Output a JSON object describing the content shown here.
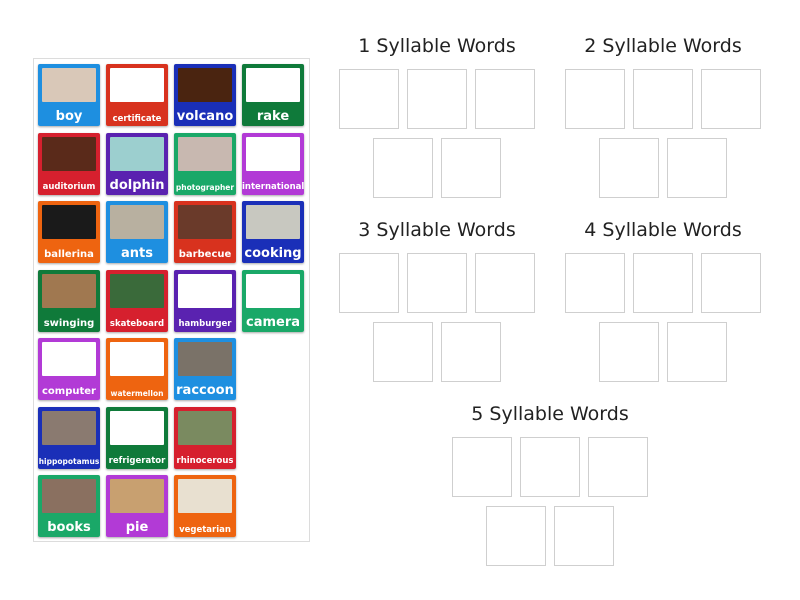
{
  "colors": {
    "blue": "#1e8fe0",
    "red": "#d8321e",
    "navy": "#1a2fb8",
    "green": "#0f7a3a",
    "crimson": "#d6202e",
    "purple": "#5a22b0",
    "teal": "#1aa868",
    "magenta": "#b23ad6",
    "orange": "#ee6410"
  },
  "cards": [
    {
      "label": "boy",
      "color": "#1e8fe0",
      "pic": "#d9c8b8",
      "size": "big"
    },
    {
      "label": "certificate",
      "color": "#d8321e",
      "pic": "#ffffff",
      "size": "small"
    },
    {
      "label": "volcano",
      "color": "#1a2fb8",
      "pic": "#4a2410",
      "size": "big"
    },
    {
      "label": "rake",
      "color": "#0f7a3a",
      "pic": "#ffffff",
      "size": "big"
    },
    {
      "label": "auditorium",
      "color": "#d6202e",
      "pic": "#5a2a1a",
      "size": "small"
    },
    {
      "label": "dolphin",
      "color": "#5a22b0",
      "pic": "#9ccfcf",
      "size": "big"
    },
    {
      "label": "photographer",
      "color": "#1aa868",
      "pic": "#c8b8b0",
      "size": "tiny"
    },
    {
      "label": "international",
      "color": "#b23ad6",
      "pic": "#ffffff",
      "size": "small"
    },
    {
      "label": "ballerina",
      "color": "#ee6410",
      "pic": "#1a1a1a",
      "size": "mid"
    },
    {
      "label": "ants",
      "color": "#1e8fe0",
      "pic": "#b8b0a0",
      "size": "big"
    },
    {
      "label": "barbecue",
      "color": "#d8321e",
      "pic": "#6a3a2a",
      "size": "mid"
    },
    {
      "label": "cooking",
      "color": "#1a2fb8",
      "pic": "#c8c8c0",
      "size": "big"
    },
    {
      "label": "swinging",
      "color": "#0f7a3a",
      "pic": "#a07850",
      "size": "mid"
    },
    {
      "label": "skateboard",
      "color": "#d6202e",
      "pic": "#3a6a3a",
      "size": "small"
    },
    {
      "label": "hamburger",
      "color": "#5a22b0",
      "pic": "#ffffff",
      "size": "small"
    },
    {
      "label": "camera",
      "color": "#1aa868",
      "pic": "#ffffff",
      "size": "big"
    },
    {
      "label": "computer",
      "color": "#b23ad6",
      "pic": "#ffffff",
      "size": "mid"
    },
    {
      "label": "watermellon",
      "color": "#ee6410",
      "pic": "#ffffff",
      "size": "tiny"
    },
    {
      "label": "raccoon",
      "color": "#1e8fe0",
      "pic": "#7a7268",
      "size": "big"
    },
    {
      "label": "hippopotamus",
      "color": "#1a2fb8",
      "pic": "#8a7a70",
      "size": "tiny"
    },
    {
      "label": "refrigerator",
      "color": "#0f7a3a",
      "pic": "#ffffff",
      "size": "small"
    },
    {
      "label": "rhinocerous",
      "color": "#d6202e",
      "pic": "#7a8a60",
      "size": "small"
    },
    {
      "label": "books",
      "color": "#1aa868",
      "pic": "#8a7060",
      "size": "big"
    },
    {
      "label": "pie",
      "color": "#b23ad6",
      "pic": "#c8a070",
      "size": "big"
    },
    {
      "label": "vegetarian",
      "color": "#ee6410",
      "pic": "#e8e0d0",
      "size": "small"
    }
  ],
  "groups": [
    {
      "title": "1 Syllable Words"
    },
    {
      "title": "2 Syllable Words"
    },
    {
      "title": "3 Syllable Words"
    },
    {
      "title": "4 Syllable Words"
    },
    {
      "title": "5 Syllable Words"
    }
  ]
}
